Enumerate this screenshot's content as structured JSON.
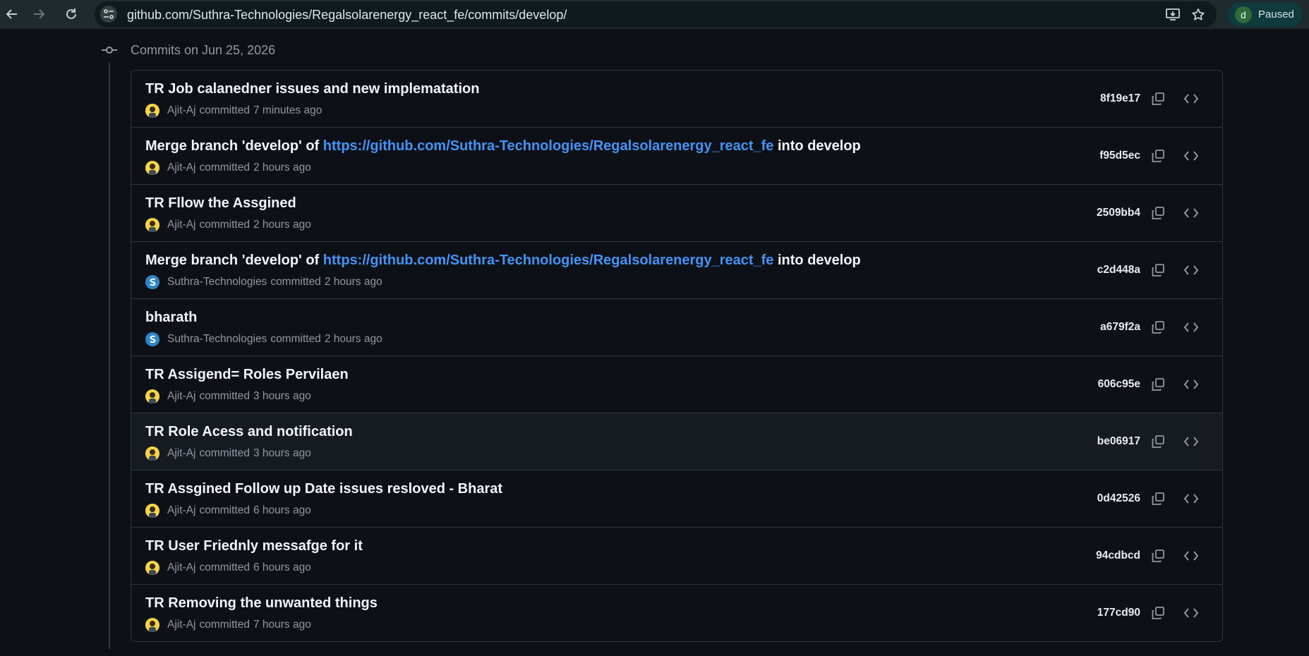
{
  "browser": {
    "url": "github.com/Suthra-Technologies/Regalsolarenergy_react_fe/commits/develop/",
    "profile_initial": "d",
    "profile_status": "Paused"
  },
  "header": {
    "date_label": "Commits on Jun 25, 2026"
  },
  "commits": [
    {
      "title": "TR Job calanedner issues and new implematation",
      "author": "Ajit-Aj",
      "avatar": "ajit-avatar",
      "verb": "committed",
      "time": "7 minutes ago",
      "sha": "8f19e17"
    },
    {
      "title_prefix": "Merge branch 'develop' of ",
      "title_link": "https://github.com/Suthra-Technologies/Regalsolarenergy_react_fe",
      "title_suffix": " into develop",
      "author": "Ajit-Aj",
      "avatar": "ajit-avatar",
      "verb": "committed",
      "time": "2 hours ago",
      "sha": "f95d5ec"
    },
    {
      "title": "TR Fllow the Assgined",
      "author": "Ajit-Aj",
      "avatar": "ajit-avatar",
      "verb": "committed",
      "time": "2 hours ago",
      "sha": "2509bb4"
    },
    {
      "title_prefix": "Merge branch 'develop' of ",
      "title_link": "https://github.com/Suthra-Technologies/Regalsolarenergy_react_fe",
      "title_suffix": " into develop",
      "author": "Suthra-Technologies",
      "avatar": "suthra-avatar",
      "verb": "committed",
      "time": "2 hours ago",
      "sha": "c2d448a"
    },
    {
      "title": "bharath",
      "author": "Suthra-Technologies",
      "avatar": "suthra-avatar",
      "verb": "committed",
      "time": "2 hours ago",
      "sha": "a679f2a"
    },
    {
      "title": "TR Assigend= Roles Pervilaen",
      "author": "Ajit-Aj",
      "avatar": "ajit-avatar",
      "verb": "committed",
      "time": "3 hours ago",
      "sha": "606c95e"
    },
    {
      "title": "TR Role Acess and notification",
      "author": "Ajit-Aj",
      "avatar": "ajit-avatar",
      "verb": "committed",
      "time": "3 hours ago",
      "sha": "be06917"
    },
    {
      "title": "TR Assgined Follow up Date issues resloved - Bharat",
      "author": "Ajit-Aj",
      "avatar": "ajit-avatar",
      "verb": "committed",
      "time": "6 hours ago",
      "sha": "0d42526"
    },
    {
      "title": "TR User Friednly messafge for it",
      "author": "Ajit-Aj",
      "avatar": "ajit-avatar",
      "verb": "committed",
      "time": "6 hours ago",
      "sha": "94cdbcd"
    },
    {
      "title": "TR Removing the unwanted things",
      "author": "Ajit-Aj",
      "avatar": "ajit-avatar",
      "verb": "committed",
      "time": "7 hours ago",
      "sha": "177cd90"
    }
  ],
  "icons": {
    "back": "back-arrow-icon",
    "forward": "forward-arrow-icon",
    "reload": "reload-icon",
    "site_info": "site-info-icon",
    "install": "install-app-icon",
    "bookmark": "bookmark-star-icon",
    "commit": "git-commit-icon",
    "copy": "copy-icon",
    "browse": "code-brackets-icon"
  },
  "colors": {
    "background": "#0d1117",
    "border": "#30363d",
    "link": "#4493f8",
    "muted": "#9198a1",
    "title": "#f0f6fc"
  }
}
